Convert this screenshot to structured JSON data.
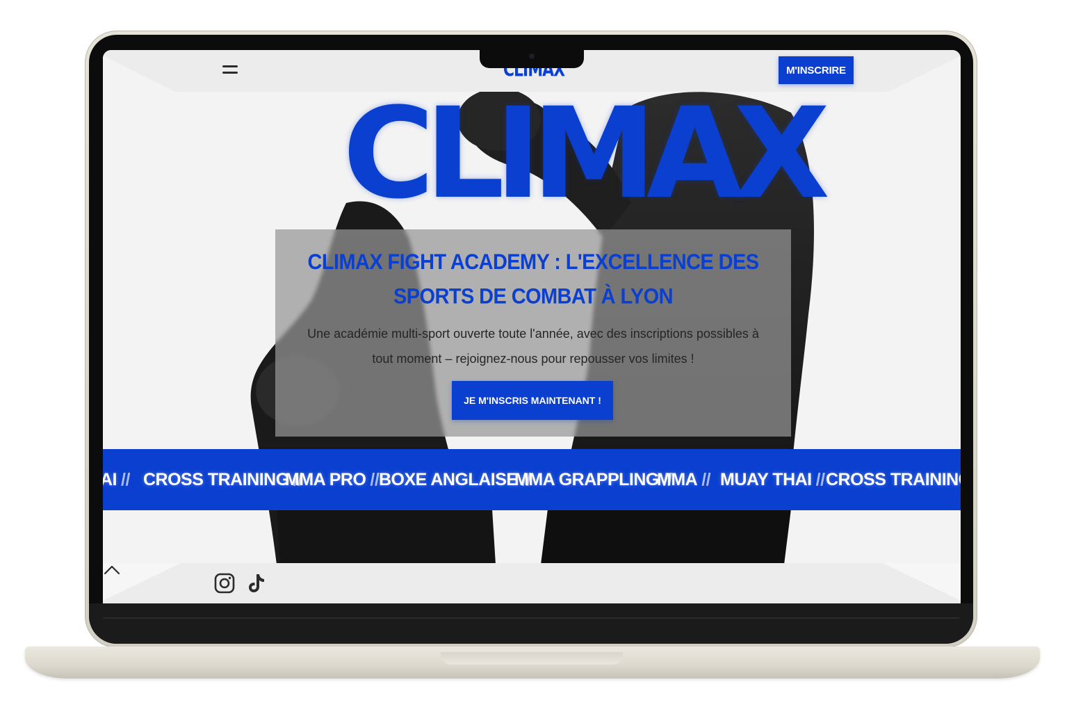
{
  "header": {
    "menu_icon": "menu-icon",
    "logo_text": "CLIMAX",
    "cta_label": "M'INSCRIRE"
  },
  "hero": {
    "background_logo": "CLIMAX",
    "title": "CLIMAX FIGHT ACADEMY : L'EXCELLENCE DES SPORTS DE COMBAT À LYON",
    "text": "Une académie multi-sport ouverte toute l'année, avec des inscriptions possibles à tout moment – rejoignez-nous pour repousser vos limites !",
    "cta_label": "JE M'INSCRIS MAINTENANT !"
  },
  "marquee": {
    "separator": "//",
    "items": [
      "AI",
      "CROSS TRAINING",
      "MMA PRO",
      "BOXE ANGLAISE",
      "MMA GRAPPLING",
      "MMA",
      "MUAY THAI",
      "CROSS TRAINING"
    ]
  },
  "footer": {
    "social_icons": [
      "instagram-icon",
      "tiktok-icon"
    ],
    "scroll_top_icon": "chevron-up-icon"
  },
  "colors": {
    "brand_blue": "#0a3fd0",
    "band_separator": "#a9bcf2",
    "card_overlay": "#969696",
    "screen_bg": "#f3f3f3"
  }
}
